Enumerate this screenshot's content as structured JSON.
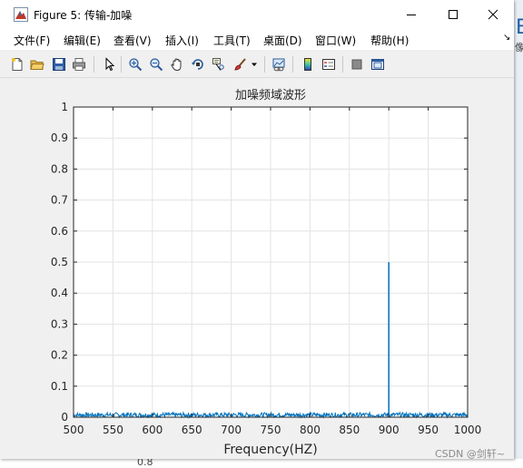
{
  "window": {
    "title": "Figure 5: 传输-加噪",
    "controls": [
      "minimize",
      "maximize",
      "close"
    ]
  },
  "menu": [
    {
      "label": "文件(F)",
      "id": "file"
    },
    {
      "label": "编辑(E)",
      "id": "edit"
    },
    {
      "label": "查看(V)",
      "id": "view"
    },
    {
      "label": "插入(I)",
      "id": "insert"
    },
    {
      "label": "工具(T)",
      "id": "tools"
    },
    {
      "label": "桌面(D)",
      "id": "desktop"
    },
    {
      "label": "窗口(W)",
      "id": "window"
    },
    {
      "label": "帮助(H)",
      "id": "help"
    }
  ],
  "toolbar": {
    "buttons": [
      "new-figure-icon",
      "open-file-icon",
      "save-icon",
      "print-icon",
      "pointer-icon",
      "zoom-in-icon",
      "zoom-out-icon",
      "pan-icon",
      "rotate-3d-icon",
      "data-cursor-icon",
      "brush-icon",
      "link-plot-icon",
      "colorbar-icon",
      "legend-icon",
      "hide-plot-tools-icon",
      "show-plot-tools-icon"
    ]
  },
  "background_fragments": {
    "right_top": "B",
    "right_small": "像",
    "left_small": "谱",
    "bottom_tick": "0.8"
  },
  "watermark": "CSDN @剑轩~",
  "chart_data": {
    "type": "line",
    "title": "加噪频域波形",
    "xlabel": "Frequency(HZ)",
    "ylabel": "",
    "xlim": [
      500,
      1000
    ],
    "ylim": [
      0,
      1
    ],
    "xticks": [
      500,
      550,
      600,
      650,
      700,
      750,
      800,
      850,
      900,
      950,
      1000
    ],
    "yticks": [
      0,
      0.1,
      0.2,
      0.3,
      0.4,
      0.5,
      0.6,
      0.7,
      0.8,
      0.9,
      1
    ],
    "ytick_labels": [
      "0",
      "0.1",
      "0.2",
      "0.3",
      "0.4",
      "0.5",
      "0.6",
      "0.7",
      "0.8",
      "0.9",
      "1"
    ],
    "grid": true,
    "line_color": "#0072bd",
    "series": [
      {
        "noise_floor_max": 0.015,
        "peaks": [
          {
            "x": 900,
            "y": 0.5
          }
        ]
      }
    ]
  }
}
